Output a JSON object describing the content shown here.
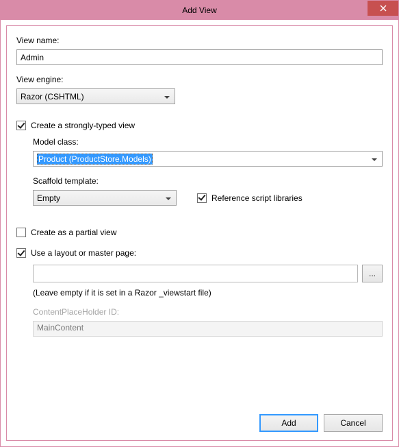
{
  "window": {
    "title": "Add View"
  },
  "viewName": {
    "label": "View name:",
    "value": "Admin"
  },
  "viewEngine": {
    "label": "View engine:",
    "value": "Razor (CSHTML)"
  },
  "stronglyTyped": {
    "label": "Create a strongly-typed view",
    "checked": true
  },
  "modelClass": {
    "label": "Model class:",
    "value": "Product (ProductStore.Models)"
  },
  "scaffold": {
    "label": "Scaffold template:",
    "value": "Empty"
  },
  "refScripts": {
    "label": "Reference script libraries",
    "checked": true
  },
  "partialView": {
    "label": "Create as a partial view",
    "checked": false
  },
  "useLayout": {
    "label": "Use a layout or master page:",
    "checked": true
  },
  "layoutPath": {
    "value": "",
    "browseLabel": "...",
    "hint": "(Leave empty if it is set in a Razor _viewstart file)"
  },
  "contentPlaceholder": {
    "label": "ContentPlaceHolder ID:",
    "value": "MainContent"
  },
  "buttons": {
    "add": "Add",
    "cancel": "Cancel"
  }
}
